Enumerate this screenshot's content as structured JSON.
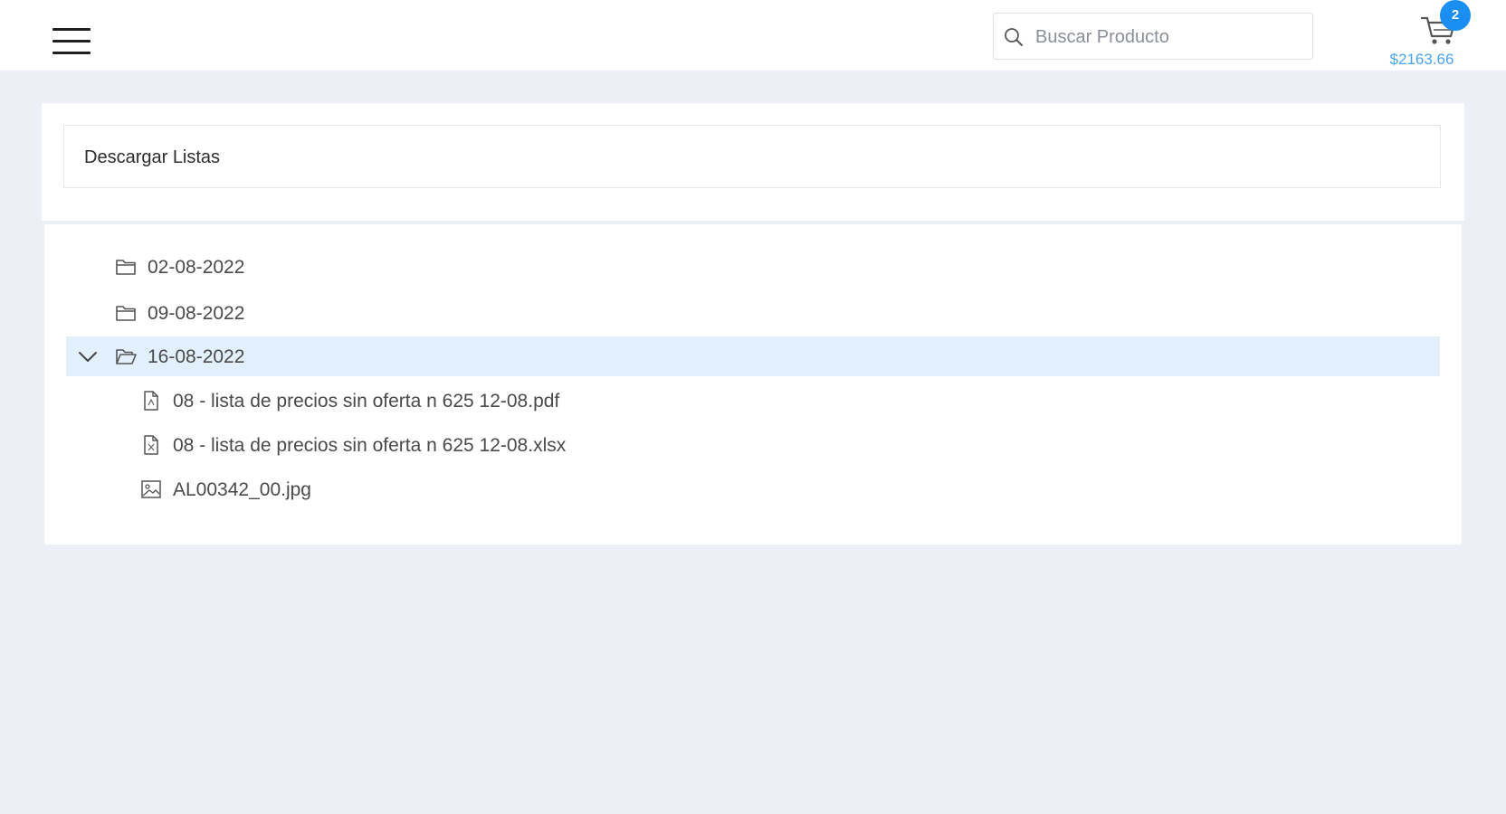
{
  "header": {
    "menu_icon": "hamburger-icon",
    "search": {
      "placeholder": "Buscar Producto",
      "value": "",
      "icon": "search-icon"
    },
    "cart": {
      "icon": "cart-icon",
      "count": "2",
      "total": "$2163.66",
      "badge_color": "#1b8ef3",
      "total_color": "#4aa3f0"
    }
  },
  "panel": {
    "title": "Descargar Listas"
  },
  "tree": {
    "selected_color": "#e2f0fd",
    "nodes": [
      {
        "label": "02-08-2022",
        "type": "folder",
        "icon": "folder-icon",
        "expanded": false
      },
      {
        "label": "09-08-2022",
        "type": "folder",
        "icon": "folder-icon",
        "expanded": false
      },
      {
        "label": "16-08-2022",
        "type": "folder",
        "icon": "folder-open-icon",
        "expanded": true,
        "selected": true,
        "children": [
          {
            "label": "08 - lista de precios sin oferta n 625 12-08.pdf",
            "type": "file",
            "icon": "file-icon"
          },
          {
            "label": "08 - lista de precios sin oferta n 625 12-08.xlsx",
            "type": "file",
            "icon": "file-icon"
          },
          {
            "label": "AL00342_00.jpg",
            "type": "image",
            "icon": "image-icon"
          }
        ]
      }
    ]
  }
}
